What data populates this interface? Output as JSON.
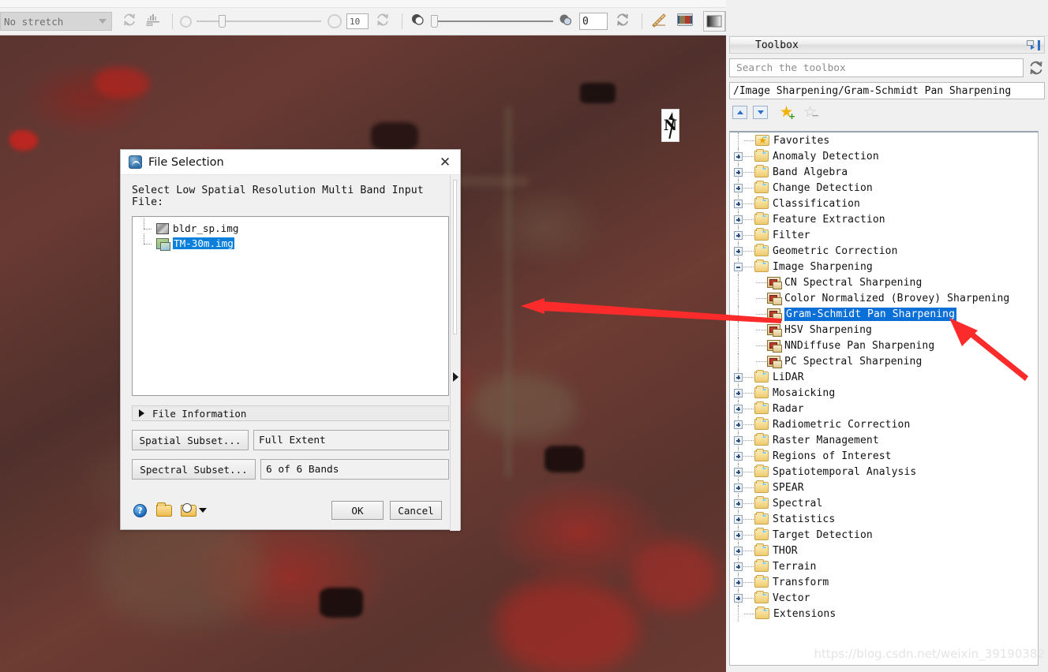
{
  "toolbar": {
    "stretch_label": "No stretch",
    "refresh_icon": "refresh-icon",
    "histogram_icon": "histogram-stretch-icon",
    "transparency_value": "10",
    "blend_value": "0",
    "ruler_icon": "measure-icon",
    "crop_icon": "image-crop-icon",
    "portal_icon": "portal-icon",
    "layers_icon": "layer-stack-icon",
    "split_icon": "split-view-icon"
  },
  "map": {
    "north_arrow_label": "N"
  },
  "dialog": {
    "title": "File Selection",
    "close_label": "✕",
    "prompt": "Select Low Spatial Resolution Multi Band Input File:",
    "files": [
      {
        "name": "bldr_sp.img",
        "selected": false
      },
      {
        "name": "TM-30m.img",
        "selected": true
      }
    ],
    "file_information_label": "File Information",
    "spatial_subset_button": "Spatial Subset...",
    "spatial_subset_value": "Full Extent",
    "spectral_subset_button": "Spectral Subset...",
    "spectral_subset_value": "6 of 6 Bands",
    "help_label": "?",
    "open_icon": "open-folder-icon",
    "recent_icon": "recent-files-icon",
    "ok_label": "OK",
    "cancel_label": "Cancel"
  },
  "toolbox": {
    "panel_title": "Toolbox",
    "dock_icon": "dock-panel-icon",
    "search_placeholder": "Search the toolbox",
    "search_value": "",
    "refresh_icon": "refresh-icon",
    "breadcrumb": "/Image Sharpening/Gram-Schmidt Pan Sharpening",
    "nav": {
      "up_label": "move-up",
      "down_label": "move-down",
      "add_favorite_label": "add-to-favorites",
      "remove_favorite_label": "remove-from-favorites"
    },
    "tree": [
      {
        "label": "Favorites",
        "type": "favorites",
        "state": "leaf"
      },
      {
        "label": "Anomaly Detection",
        "type": "folder",
        "state": "collapsed"
      },
      {
        "label": "Band Algebra",
        "type": "folder",
        "state": "collapsed"
      },
      {
        "label": "Change Detection",
        "type": "folder",
        "state": "collapsed"
      },
      {
        "label": "Classification",
        "type": "folder",
        "state": "collapsed"
      },
      {
        "label": "Feature Extraction",
        "type": "folder",
        "state": "collapsed"
      },
      {
        "label": "Filter",
        "type": "folder",
        "state": "collapsed"
      },
      {
        "label": "Geometric Correction",
        "type": "folder",
        "state": "collapsed"
      },
      {
        "label": "Image Sharpening",
        "type": "folder",
        "state": "expanded"
      },
      {
        "label": "CN Spectral Sharpening",
        "type": "tool",
        "state": "child",
        "selected": false
      },
      {
        "label": "Color Normalized (Brovey) Sharpening",
        "type": "tool",
        "state": "child",
        "selected": false
      },
      {
        "label": "Gram-Schmidt Pan Sharpening",
        "type": "tool",
        "state": "child",
        "selected": true
      },
      {
        "label": "HSV Sharpening",
        "type": "tool",
        "state": "child",
        "selected": false
      },
      {
        "label": "NNDiffuse Pan Sharpening",
        "type": "tool",
        "state": "child",
        "selected": false
      },
      {
        "label": "PC Spectral Sharpening",
        "type": "tool",
        "state": "child",
        "selected": false
      },
      {
        "label": "LiDAR",
        "type": "folder",
        "state": "collapsed"
      },
      {
        "label": "Mosaicking",
        "type": "folder",
        "state": "collapsed"
      },
      {
        "label": "Radar",
        "type": "folder",
        "state": "collapsed"
      },
      {
        "label": "Radiometric Correction",
        "type": "folder",
        "state": "collapsed"
      },
      {
        "label": "Raster Management",
        "type": "folder",
        "state": "collapsed"
      },
      {
        "label": "Regions of Interest",
        "type": "folder",
        "state": "collapsed"
      },
      {
        "label": "Spatiotemporal Analysis",
        "type": "folder",
        "state": "collapsed"
      },
      {
        "label": "SPEAR",
        "type": "folder",
        "state": "collapsed"
      },
      {
        "label": "Spectral",
        "type": "folder",
        "state": "collapsed"
      },
      {
        "label": "Statistics",
        "type": "folder",
        "state": "collapsed"
      },
      {
        "label": "Target Detection",
        "type": "folder",
        "state": "collapsed"
      },
      {
        "label": "THOR",
        "type": "folder",
        "state": "collapsed"
      },
      {
        "label": "Terrain",
        "type": "folder",
        "state": "collapsed"
      },
      {
        "label": "Transform",
        "type": "folder",
        "state": "collapsed"
      },
      {
        "label": "Vector",
        "type": "folder",
        "state": "collapsed"
      },
      {
        "label": "Extensions",
        "type": "folder",
        "state": "leaf"
      }
    ]
  },
  "annotations": {
    "arrow_color": "#fb2b2b",
    "arrow_1": "points-left-to-map",
    "arrow_2": "points-to-gram-schmidt-item"
  },
  "watermark": "https://blog.csdn.net/weixin_39190382"
}
